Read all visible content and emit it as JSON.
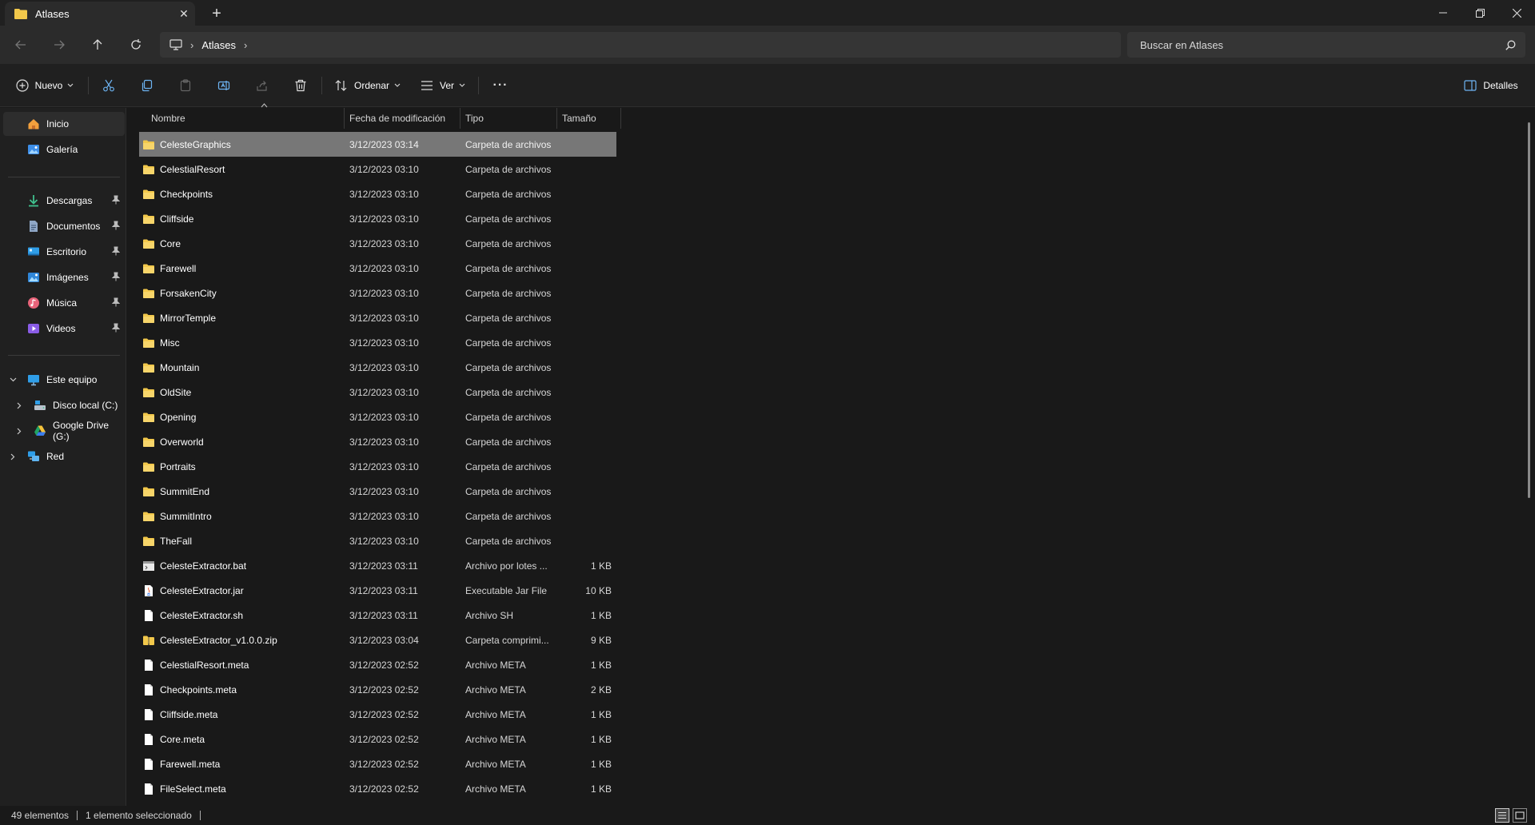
{
  "titlebar": {
    "tab_title": "Atlases",
    "new_tab_label": "+"
  },
  "address": {
    "crumb": "Atlases",
    "search_placeholder": "Buscar en Atlases"
  },
  "commands": {
    "new": "Nuevo",
    "sort": "Ordenar",
    "view": "Ver",
    "more": "···",
    "details": "Detalles"
  },
  "sidebar": {
    "quick": [
      {
        "label": "Inicio",
        "icon": "home-icon"
      },
      {
        "label": "Galería",
        "icon": "gallery-icon"
      }
    ],
    "pinned": [
      {
        "label": "Descargas",
        "icon": "download-icon"
      },
      {
        "label": "Documentos",
        "icon": "documents-icon"
      },
      {
        "label": "Escritorio",
        "icon": "desktop-icon"
      },
      {
        "label": "Imágenes",
        "icon": "pictures-icon"
      },
      {
        "label": "Música",
        "icon": "music-icon"
      },
      {
        "label": "Videos",
        "icon": "videos-icon"
      }
    ],
    "tree": [
      {
        "label": "Este equipo",
        "icon": "pc-icon"
      },
      {
        "label": "Disco local (C:)",
        "icon": "drive-icon"
      },
      {
        "label": "Google Drive (G:)",
        "icon": "google-drive-icon"
      },
      {
        "label": "Red",
        "icon": "network-icon"
      }
    ]
  },
  "columns": {
    "name": "Nombre",
    "date": "Fecha de modificación",
    "type": "Tipo",
    "size": "Tamaño"
  },
  "files": [
    {
      "name": "CelesteGraphics",
      "date": "3/12/2023 03:14",
      "type": "Carpeta de archivos",
      "size": "",
      "kind": "folder",
      "selected": true
    },
    {
      "name": "CelestialResort",
      "date": "3/12/2023 03:10",
      "type": "Carpeta de archivos",
      "size": "",
      "kind": "folder"
    },
    {
      "name": "Checkpoints",
      "date": "3/12/2023 03:10",
      "type": "Carpeta de archivos",
      "size": "",
      "kind": "folder"
    },
    {
      "name": "Cliffside",
      "date": "3/12/2023 03:10",
      "type": "Carpeta de archivos",
      "size": "",
      "kind": "folder"
    },
    {
      "name": "Core",
      "date": "3/12/2023 03:10",
      "type": "Carpeta de archivos",
      "size": "",
      "kind": "folder"
    },
    {
      "name": "Farewell",
      "date": "3/12/2023 03:10",
      "type": "Carpeta de archivos",
      "size": "",
      "kind": "folder"
    },
    {
      "name": "ForsakenCity",
      "date": "3/12/2023 03:10",
      "type": "Carpeta de archivos",
      "size": "",
      "kind": "folder"
    },
    {
      "name": "MirrorTemple",
      "date": "3/12/2023 03:10",
      "type": "Carpeta de archivos",
      "size": "",
      "kind": "folder"
    },
    {
      "name": "Misc",
      "date": "3/12/2023 03:10",
      "type": "Carpeta de archivos",
      "size": "",
      "kind": "folder"
    },
    {
      "name": "Mountain",
      "date": "3/12/2023 03:10",
      "type": "Carpeta de archivos",
      "size": "",
      "kind": "folder"
    },
    {
      "name": "OldSite",
      "date": "3/12/2023 03:10",
      "type": "Carpeta de archivos",
      "size": "",
      "kind": "folder"
    },
    {
      "name": "Opening",
      "date": "3/12/2023 03:10",
      "type": "Carpeta de archivos",
      "size": "",
      "kind": "folder"
    },
    {
      "name": "Overworld",
      "date": "3/12/2023 03:10",
      "type": "Carpeta de archivos",
      "size": "",
      "kind": "folder"
    },
    {
      "name": "Portraits",
      "date": "3/12/2023 03:10",
      "type": "Carpeta de archivos",
      "size": "",
      "kind": "folder"
    },
    {
      "name": "SummitEnd",
      "date": "3/12/2023 03:10",
      "type": "Carpeta de archivos",
      "size": "",
      "kind": "folder"
    },
    {
      "name": "SummitIntro",
      "date": "3/12/2023 03:10",
      "type": "Carpeta de archivos",
      "size": "",
      "kind": "folder"
    },
    {
      "name": "TheFall",
      "date": "3/12/2023 03:10",
      "type": "Carpeta de archivos",
      "size": "",
      "kind": "folder"
    },
    {
      "name": "CelesteExtractor.bat",
      "date": "3/12/2023 03:11",
      "type": "Archivo por lotes ...",
      "size": "1 KB",
      "kind": "bat"
    },
    {
      "name": "CelesteExtractor.jar",
      "date": "3/12/2023 03:11",
      "type": "Executable Jar File",
      "size": "10 KB",
      "kind": "jar"
    },
    {
      "name": "CelesteExtractor.sh",
      "date": "3/12/2023 03:11",
      "type": "Archivo SH",
      "size": "1 KB",
      "kind": "file"
    },
    {
      "name": "CelesteExtractor_v1.0.0.zip",
      "date": "3/12/2023 03:04",
      "type": "Carpeta comprimi...",
      "size": "9 KB",
      "kind": "zip"
    },
    {
      "name": "CelestialResort.meta",
      "date": "3/12/2023 02:52",
      "type": "Archivo META",
      "size": "1 KB",
      "kind": "file"
    },
    {
      "name": "Checkpoints.meta",
      "date": "3/12/2023 02:52",
      "type": "Archivo META",
      "size": "2 KB",
      "kind": "file"
    },
    {
      "name": "Cliffside.meta",
      "date": "3/12/2023 02:52",
      "type": "Archivo META",
      "size": "1 KB",
      "kind": "file"
    },
    {
      "name": "Core.meta",
      "date": "3/12/2023 02:52",
      "type": "Archivo META",
      "size": "1 KB",
      "kind": "file"
    },
    {
      "name": "Farewell.meta",
      "date": "3/12/2023 02:52",
      "type": "Archivo META",
      "size": "1 KB",
      "kind": "file"
    },
    {
      "name": "FileSelect.meta",
      "date": "3/12/2023 02:52",
      "type": "Archivo META",
      "size": "1 KB",
      "kind": "file"
    }
  ],
  "status": {
    "count": "49 elementos",
    "selection": "1 elemento seleccionado"
  },
  "colors": {
    "folder": "#f2c84b",
    "accent": "#4cc2ff",
    "selected_row": "#777777"
  }
}
